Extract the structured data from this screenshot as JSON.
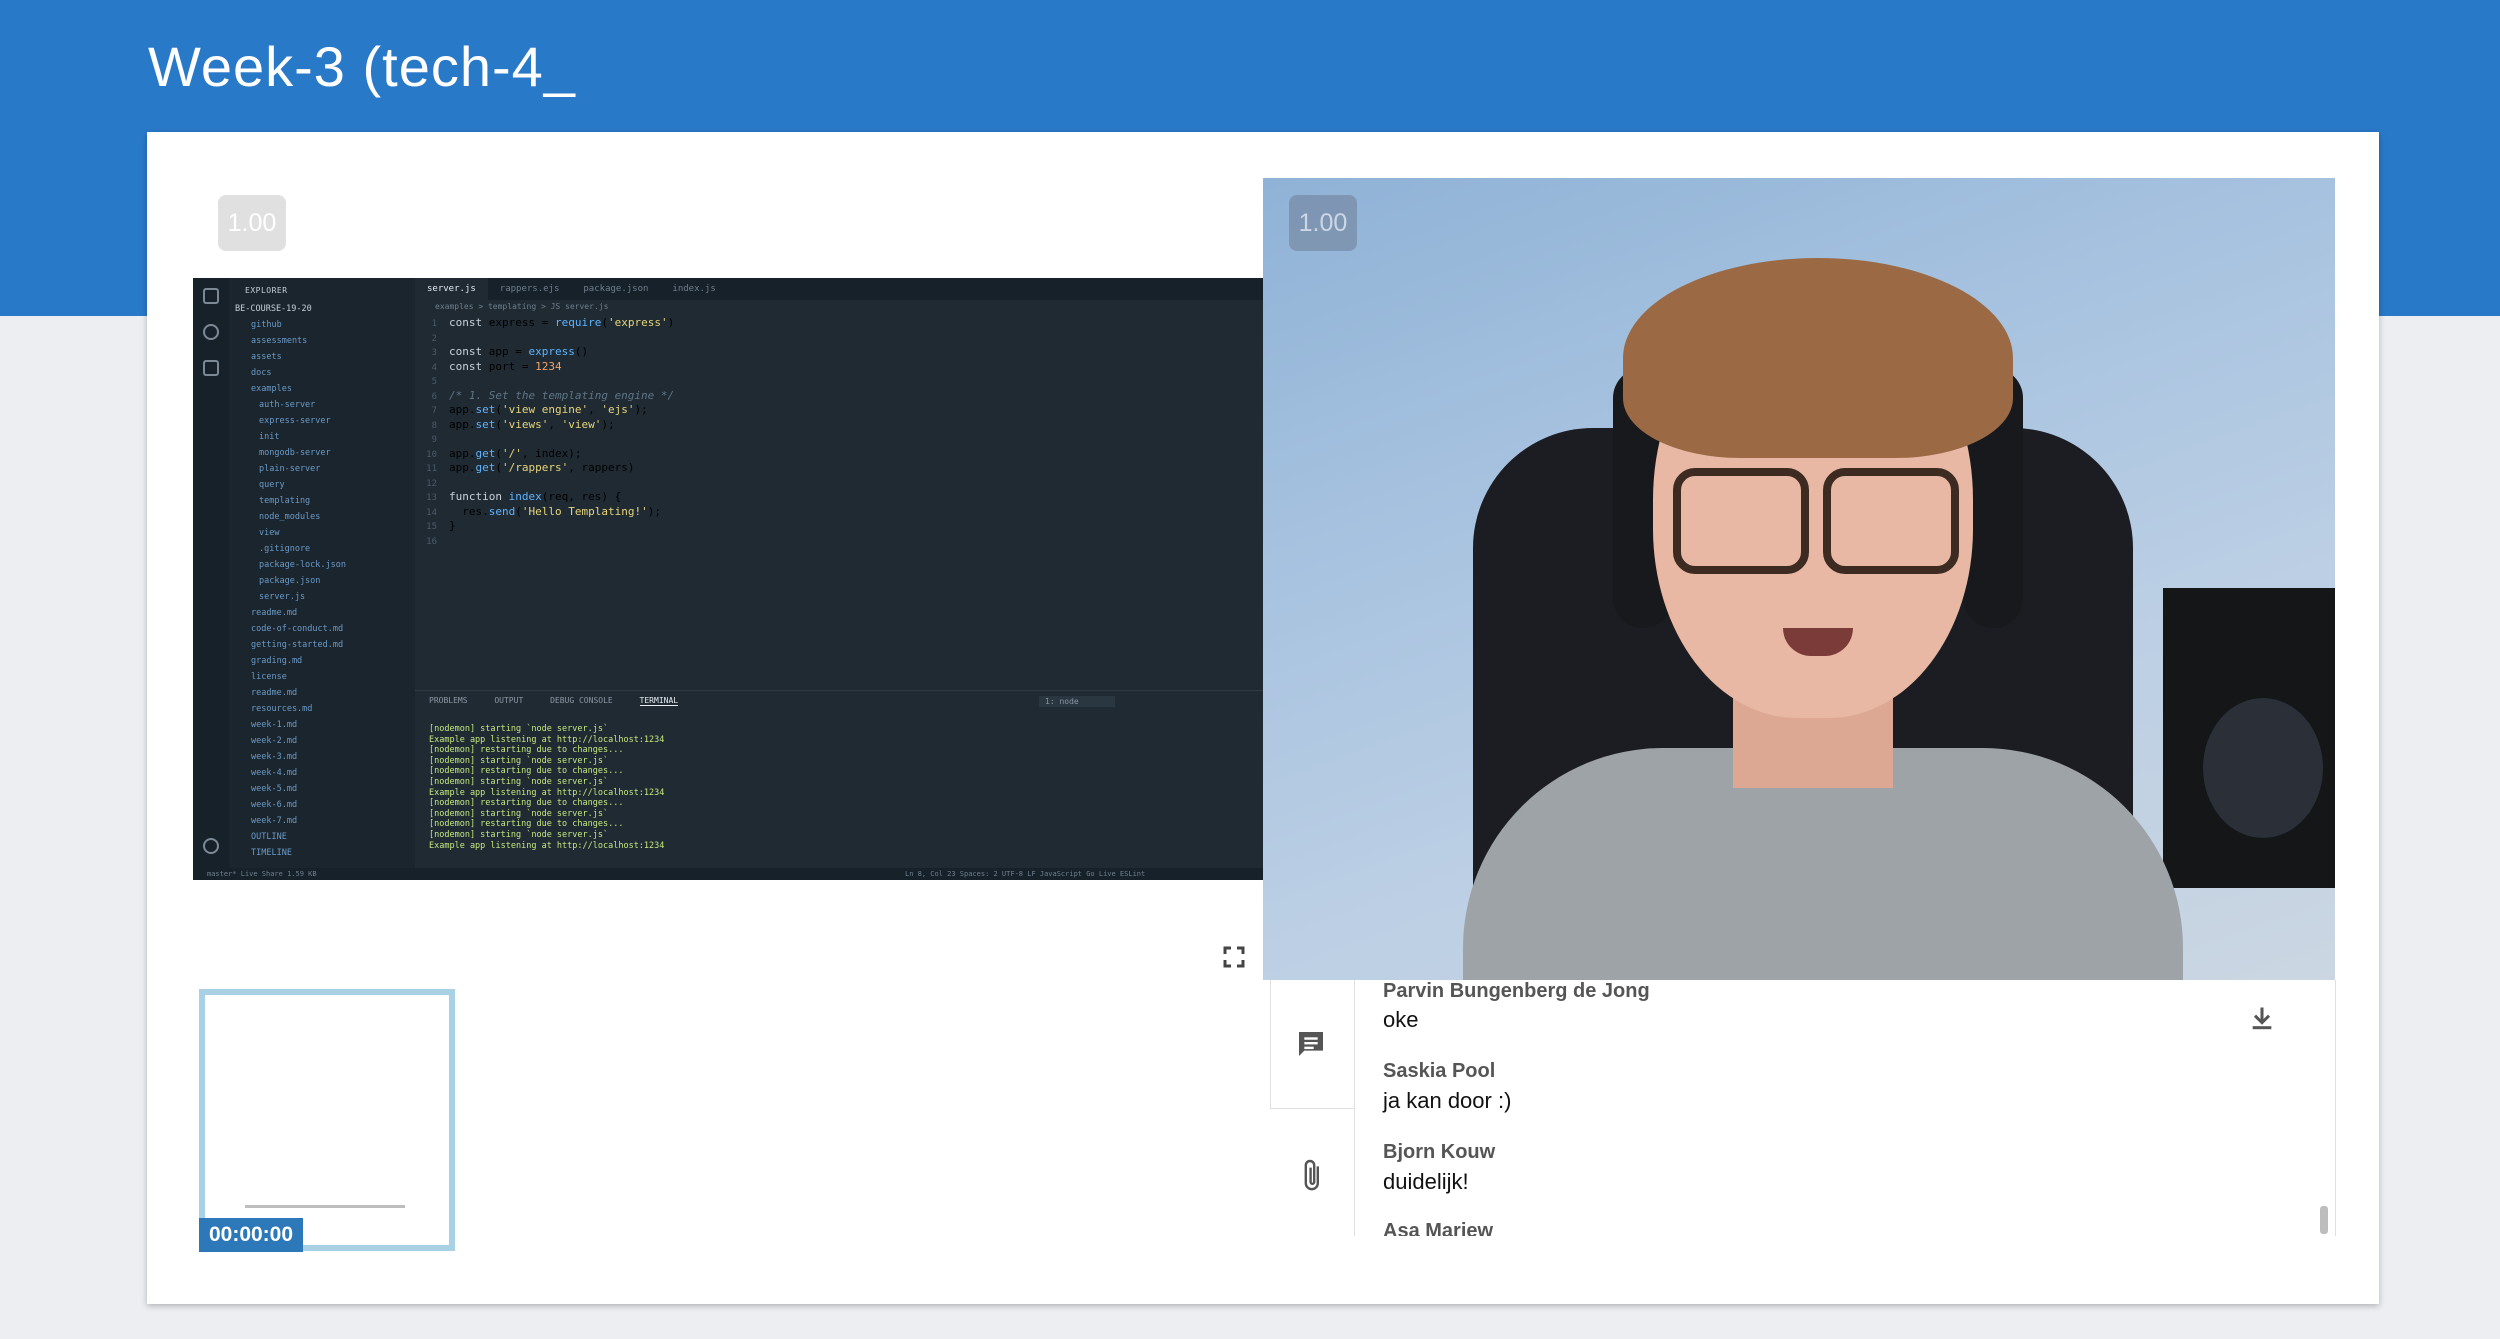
{
  "header": {
    "title": "Week-3 (tech-4_"
  },
  "players": [
    {
      "speed": "1.00"
    },
    {
      "speed": "1.00"
    }
  ],
  "screen": {
    "explorer_title": "EXPLORER",
    "tabs": [
      "server.js",
      "rappers.ejs",
      "package.json",
      "index.js"
    ],
    "breadcrumb": "examples > templating > JS server.js",
    "tree": [
      "BE-COURSE-19-20",
      "github",
      "assessments",
      "assets",
      "docs",
      "examples",
      "auth-server",
      "express-server",
      "init",
      "mongodb-server",
      "plain-server",
      "query",
      "templating",
      "node_modules",
      "view",
      ".gitignore",
      "package-lock.json",
      "package.json",
      "server.js",
      "readme.md",
      "code-of-conduct.md",
      "getting-started.md",
      "grading.md",
      "license",
      "readme.md",
      "resources.md",
      "week-1.md",
      "week-2.md",
      "week-3.md",
      "week-4.md",
      "week-5.md",
      "week-6.md",
      "week-7.md",
      "OUTLINE",
      "TIMELINE"
    ],
    "code": [
      "const express = require('express')",
      "",
      "const app = express()",
      "const port = 1234",
      "",
      "/* 1. Set the templating engine */",
      "app.set('view engine', 'ejs');",
      "app.set('views', 'view');",
      "",
      "app.get('/', index);",
      "app.get('/rappers', rappers)",
      "",
      "function index(req, res) {",
      "  res.send('Hello Templating!');",
      "}",
      ""
    ],
    "panel_tabs": [
      "PROBLEMS",
      "OUTPUT",
      "DEBUG CONSOLE",
      "TERMINAL"
    ],
    "terminal_select": "1: node",
    "terminal": [
      "[nodemon] starting `node server.js`",
      "Example app listening at http://localhost:1234",
      "[nodemon] restarting due to changes...",
      "[nodemon] starting `node server.js`",
      "[nodemon] restarting due to changes...",
      "[nodemon] starting `node server.js`",
      "Example app listening at http://localhost:1234",
      "[nodemon] restarting due to changes...",
      "[nodemon] starting `node server.js`",
      "[nodemon] restarting due to changes...",
      "[nodemon] starting `node server.js`",
      "Example app listening at http://localhost:1234"
    ],
    "status_left": "master*   Live Share   1.59 KB",
    "status_right": "Ln 8, Col 23   Spaces: 2   UTF-8   LF   JavaScript   Go Live   ESLint"
  },
  "thumbnail": {
    "timestamp": "00:00:00"
  },
  "chat": {
    "messages": [
      {
        "name": "Parvin Bungenberg de Jong",
        "text": "oke"
      },
      {
        "name": "Saskia Pool",
        "text": "ja kan door :)"
      },
      {
        "name": "Bjorn Kouw",
        "text": "duidelijk!"
      },
      {
        "name": "Asa Mariew",
        "text": ""
      }
    ]
  }
}
